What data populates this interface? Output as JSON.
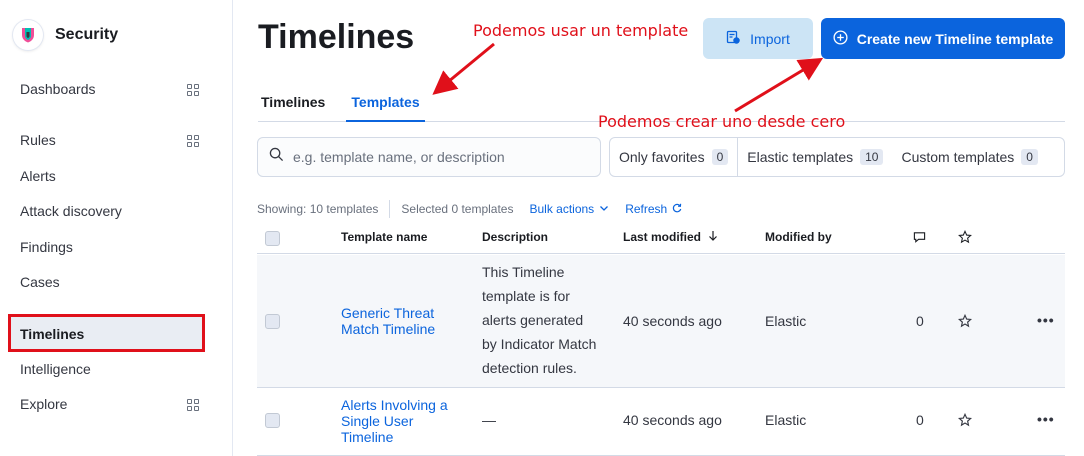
{
  "app": {
    "title": "Security"
  },
  "sidebar": {
    "items": [
      {
        "label": "Dashboards",
        "has_grid": true
      },
      {
        "label": "Rules",
        "has_grid": true
      },
      {
        "label": "Alerts"
      },
      {
        "label": "Attack discovery"
      },
      {
        "label": "Findings"
      },
      {
        "label": "Cases"
      },
      {
        "label": "Timelines",
        "active": true
      },
      {
        "label": "Intelligence"
      },
      {
        "label": "Explore",
        "has_grid": true
      }
    ]
  },
  "header": {
    "title": "Timelines",
    "import_label": "Import",
    "create_label": "Create new Timeline template"
  },
  "tabs": [
    {
      "label": "Timelines",
      "active": false
    },
    {
      "label": "Templates",
      "active": true
    }
  ],
  "search": {
    "placeholder": "e.g. template name, or description",
    "value": ""
  },
  "filters": [
    {
      "label": "Only favorites",
      "count": "0"
    },
    {
      "label": "Elastic templates",
      "count": "10"
    },
    {
      "label": "Custom templates",
      "count": "0"
    }
  ],
  "meta": {
    "showing": "Showing: 10 templates",
    "selected": "Selected 0 templates",
    "bulk_actions": "Bulk actions",
    "refresh": "Refresh"
  },
  "table": {
    "columns": [
      "Template name",
      "Description",
      "Last modified",
      "Modified by"
    ],
    "rows": [
      {
        "name_lines": [
          "Generic Threat",
          "Match Timeline"
        ],
        "description_lines": [
          "This Timeline",
          "template is for",
          "alerts generated",
          "by Indicator Match",
          "detection rules."
        ],
        "last_modified": "40 seconds ago",
        "modified_by": "Elastic",
        "notes": "0"
      },
      {
        "name_lines": [
          "Alerts Involving a",
          "Single User",
          "Timeline"
        ],
        "description": "—",
        "last_modified": "40 seconds ago",
        "modified_by": "Elastic",
        "notes": "0"
      }
    ]
  },
  "annotations": {
    "template_note": "Podemos usar un template",
    "create_note": "Podemos crear uno desde cero"
  },
  "colors": {
    "accent": "#0b64dd",
    "annotation": "#e0101a",
    "import_bg": "#cce4f5"
  },
  "icons": [
    "security-logo-icon",
    "grid-icon",
    "import-icon",
    "plus-circle-icon",
    "search-icon",
    "chevron-down-icon",
    "refresh-icon",
    "sort-down-icon",
    "comment-icon",
    "star-icon",
    "more-actions-icon"
  ]
}
